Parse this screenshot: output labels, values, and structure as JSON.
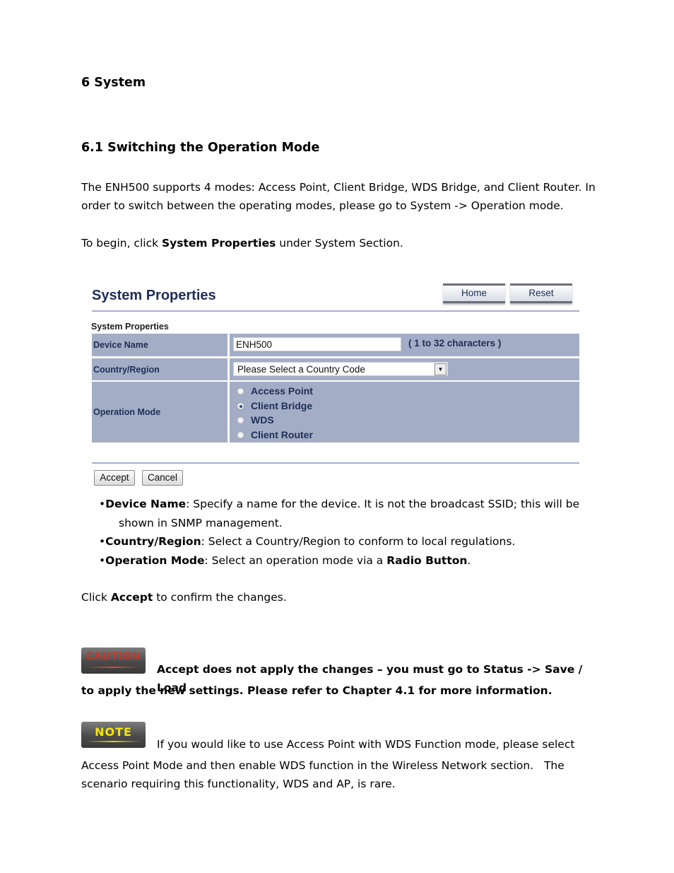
{
  "headings": {
    "section": "6 System",
    "subsection": "6.1 Switching the Operation Mode"
  },
  "intro": {
    "line1": "The ENH500 supports 4 modes: Access Point, Client Bridge, WDS Bridge, and Client Router. In",
    "line2": "order to switch between the operating modes, please go to System -> Operation mode."
  },
  "begin": {
    "prefix": "To begin, click ",
    "bold": "System Properties",
    "suffix": " under System Section."
  },
  "ui": {
    "title": "System Properties",
    "home_button": "Home",
    "reset_button": "Reset",
    "section_label": "System Properties",
    "device_name_label": "Device Name",
    "device_name_value": "ENH500",
    "device_name_hint": "( 1 to 32 characters )",
    "country_label": "Country/Region",
    "country_selected": "Please Select a Country Code",
    "operation_mode_label": "Operation Mode",
    "modes": [
      {
        "label": "Access Point",
        "checked": false
      },
      {
        "label": "Client Bridge",
        "checked": true
      },
      {
        "label": "WDS",
        "checked": false
      },
      {
        "label": "Client Router",
        "checked": false
      }
    ],
    "accept_button": "Accept",
    "cancel_button": "Cancel"
  },
  "bullets": [
    {
      "term": "Device Name",
      "text": ": Specify a name for the device. It is not the broadcast SSID; this will be",
      "cont": "shown in SNMP management."
    },
    {
      "term": "Country/Region",
      "text": ": Select a Country/Region to conform to local regulations."
    },
    {
      "term": "Operation Mode",
      "text": ": Select an operation mode via a ",
      "bold2": "Radio Button",
      "end": "."
    }
  ],
  "click_accept": {
    "prefix": "Click ",
    "bold": "Accept",
    "suffix": " to confirm the changes."
  },
  "caution": {
    "badge": "CAUTION",
    "line1": "Accept does not apply the changes – you must go to Status -> Save / Load",
    "line2": "to apply the new settings. Please refer to Chapter 4.1 for more information.",
    "color": "#c0392b"
  },
  "note": {
    "badge": "NOTE",
    "line1": "If you would like to use Access Point with WDS Function mode, please select",
    "line2": "Access Point Mode and then enable WDS function in the Wireless Network section.   The",
    "line3": "scenario requiring this functionality, WDS and AP, is rare.",
    "color": "#f5e600"
  }
}
